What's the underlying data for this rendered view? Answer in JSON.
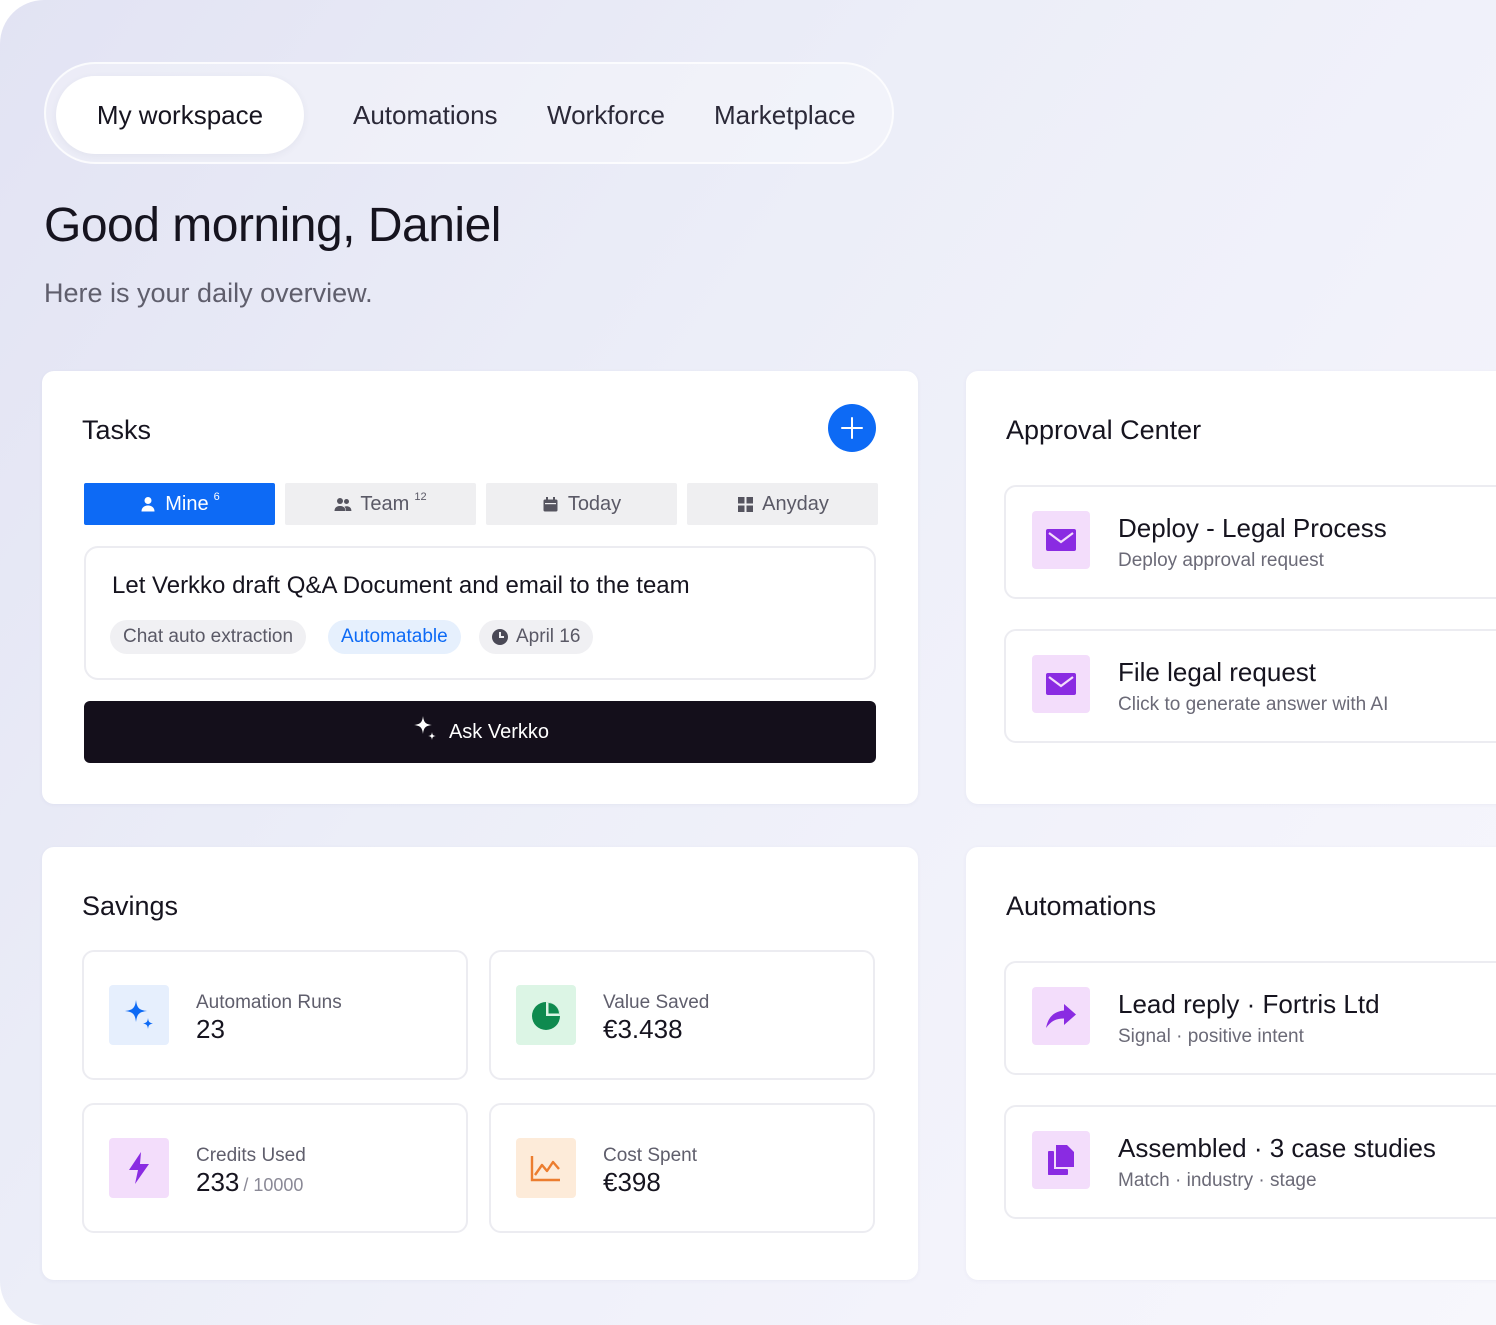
{
  "nav": {
    "tabs": [
      {
        "label": "My workspace",
        "active": true
      },
      {
        "label": "Automations",
        "active": false
      },
      {
        "label": "Workforce",
        "active": false
      },
      {
        "label": "Marketplace",
        "active": false
      }
    ]
  },
  "header": {
    "greeting": "Good morning, Daniel",
    "subtitle": "Here is your daily overview."
  },
  "tasks": {
    "title": "Tasks",
    "filters": [
      {
        "label": "Mine",
        "count": "6",
        "icon": "user-icon",
        "active": true
      },
      {
        "label": "Team",
        "count": "12",
        "icon": "users-icon",
        "active": false
      },
      {
        "label": "Today",
        "count": "",
        "icon": "calendar-icon",
        "active": false
      },
      {
        "label": "Anyday",
        "count": "",
        "icon": "grid-icon",
        "active": false
      }
    ],
    "item": {
      "title": "Let Verkko draft Q&A Document and email to the team",
      "tags": [
        "Chat auto extraction",
        "Automatable"
      ],
      "date": "April 16"
    },
    "ask_label": "Ask Verkko"
  },
  "approval": {
    "title": "Approval Center",
    "items": [
      {
        "title": "Deploy - Legal Process",
        "subtitle": "Deploy approval request",
        "icon": "mail-icon"
      },
      {
        "title": "File legal request",
        "subtitle": "Click to generate answer with AI",
        "icon": "mail-icon"
      }
    ]
  },
  "savings": {
    "title": "Savings",
    "stats": [
      {
        "label": "Automation Runs",
        "value": "23",
        "unit": "",
        "icon": "sparkle-icon"
      },
      {
        "label": "Value Saved",
        "value": "€3.438",
        "unit": "",
        "icon": "pie-chart-icon"
      },
      {
        "label": "Credits Used",
        "value": "233",
        "unit": "/ 10000",
        "icon": "lightning-icon"
      },
      {
        "label": "Cost Spent",
        "value": "€398",
        "unit": "",
        "icon": "line-chart-icon"
      }
    ]
  },
  "automations": {
    "title": "Automations",
    "items": [
      {
        "title": "Lead reply · Fortris Ltd",
        "subtitle": "Signal · positive intent",
        "icon": "reply-arrow-icon"
      },
      {
        "title": "Assembled · 3 case studies",
        "subtitle": "Match · industry · stage",
        "icon": "documents-icon"
      }
    ]
  },
  "colors": {
    "accent": "#0d6af5",
    "dark_button": "#140f1b",
    "purple_icon": "#8a2be2",
    "purple_icon_bg": "#f3ddfb",
    "blue_icon_bg": "#e6effd",
    "green_icon": "#0f8a4f",
    "green_icon_bg": "#dcf5e5",
    "orange_icon": "#ec7d2f",
    "orange_icon_bg": "#fdebd9"
  }
}
